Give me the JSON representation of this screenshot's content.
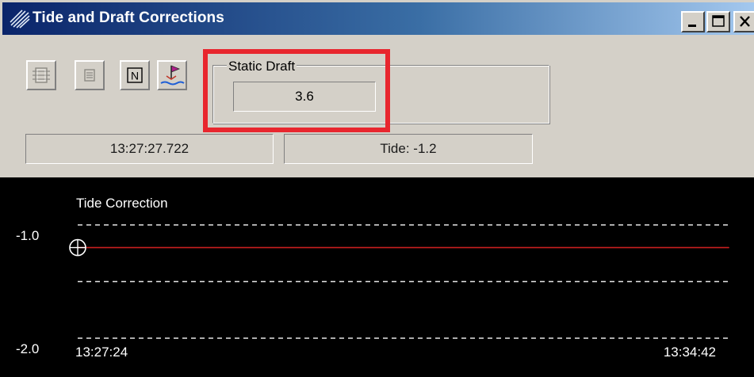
{
  "window": {
    "title": "Tide and Draft Corrections",
    "title_icon": "globe-wave-icon",
    "buttons": [
      "minimize-icon",
      "maximize-icon",
      "close-icon"
    ]
  },
  "toolbar": {
    "buttons": [
      {
        "name": "frame-icon",
        "enabled": false
      },
      {
        "name": "list-icon",
        "enabled": false
      },
      {
        "name": "n-icon",
        "enabled": true
      },
      {
        "name": "sounding-icon",
        "enabled": true
      }
    ]
  },
  "static_draft": {
    "label": "Static Draft",
    "value": "3.6"
  },
  "status": {
    "time": "13:27:27.722",
    "tide": "Tide: -1.2"
  },
  "highlight_color": "#e8262e",
  "chart_data": {
    "type": "line",
    "title": "Tide Correction",
    "series": [
      {
        "color": "#c81e1e",
        "x": [
          "13:27:24",
          "13:34:42"
        ],
        "values": [
          -1.2,
          -1.2
        ]
      }
    ],
    "y_ticks": [
      "-1.0",
      "-2.0"
    ],
    "ylim": [
      -2.0,
      -0.75
    ],
    "x_ticks": [
      "13:27:24",
      "13:34:42"
    ],
    "cursor": {
      "x": "13:27:24",
      "y": -1.2
    },
    "grid": true,
    "background": "#000000"
  }
}
